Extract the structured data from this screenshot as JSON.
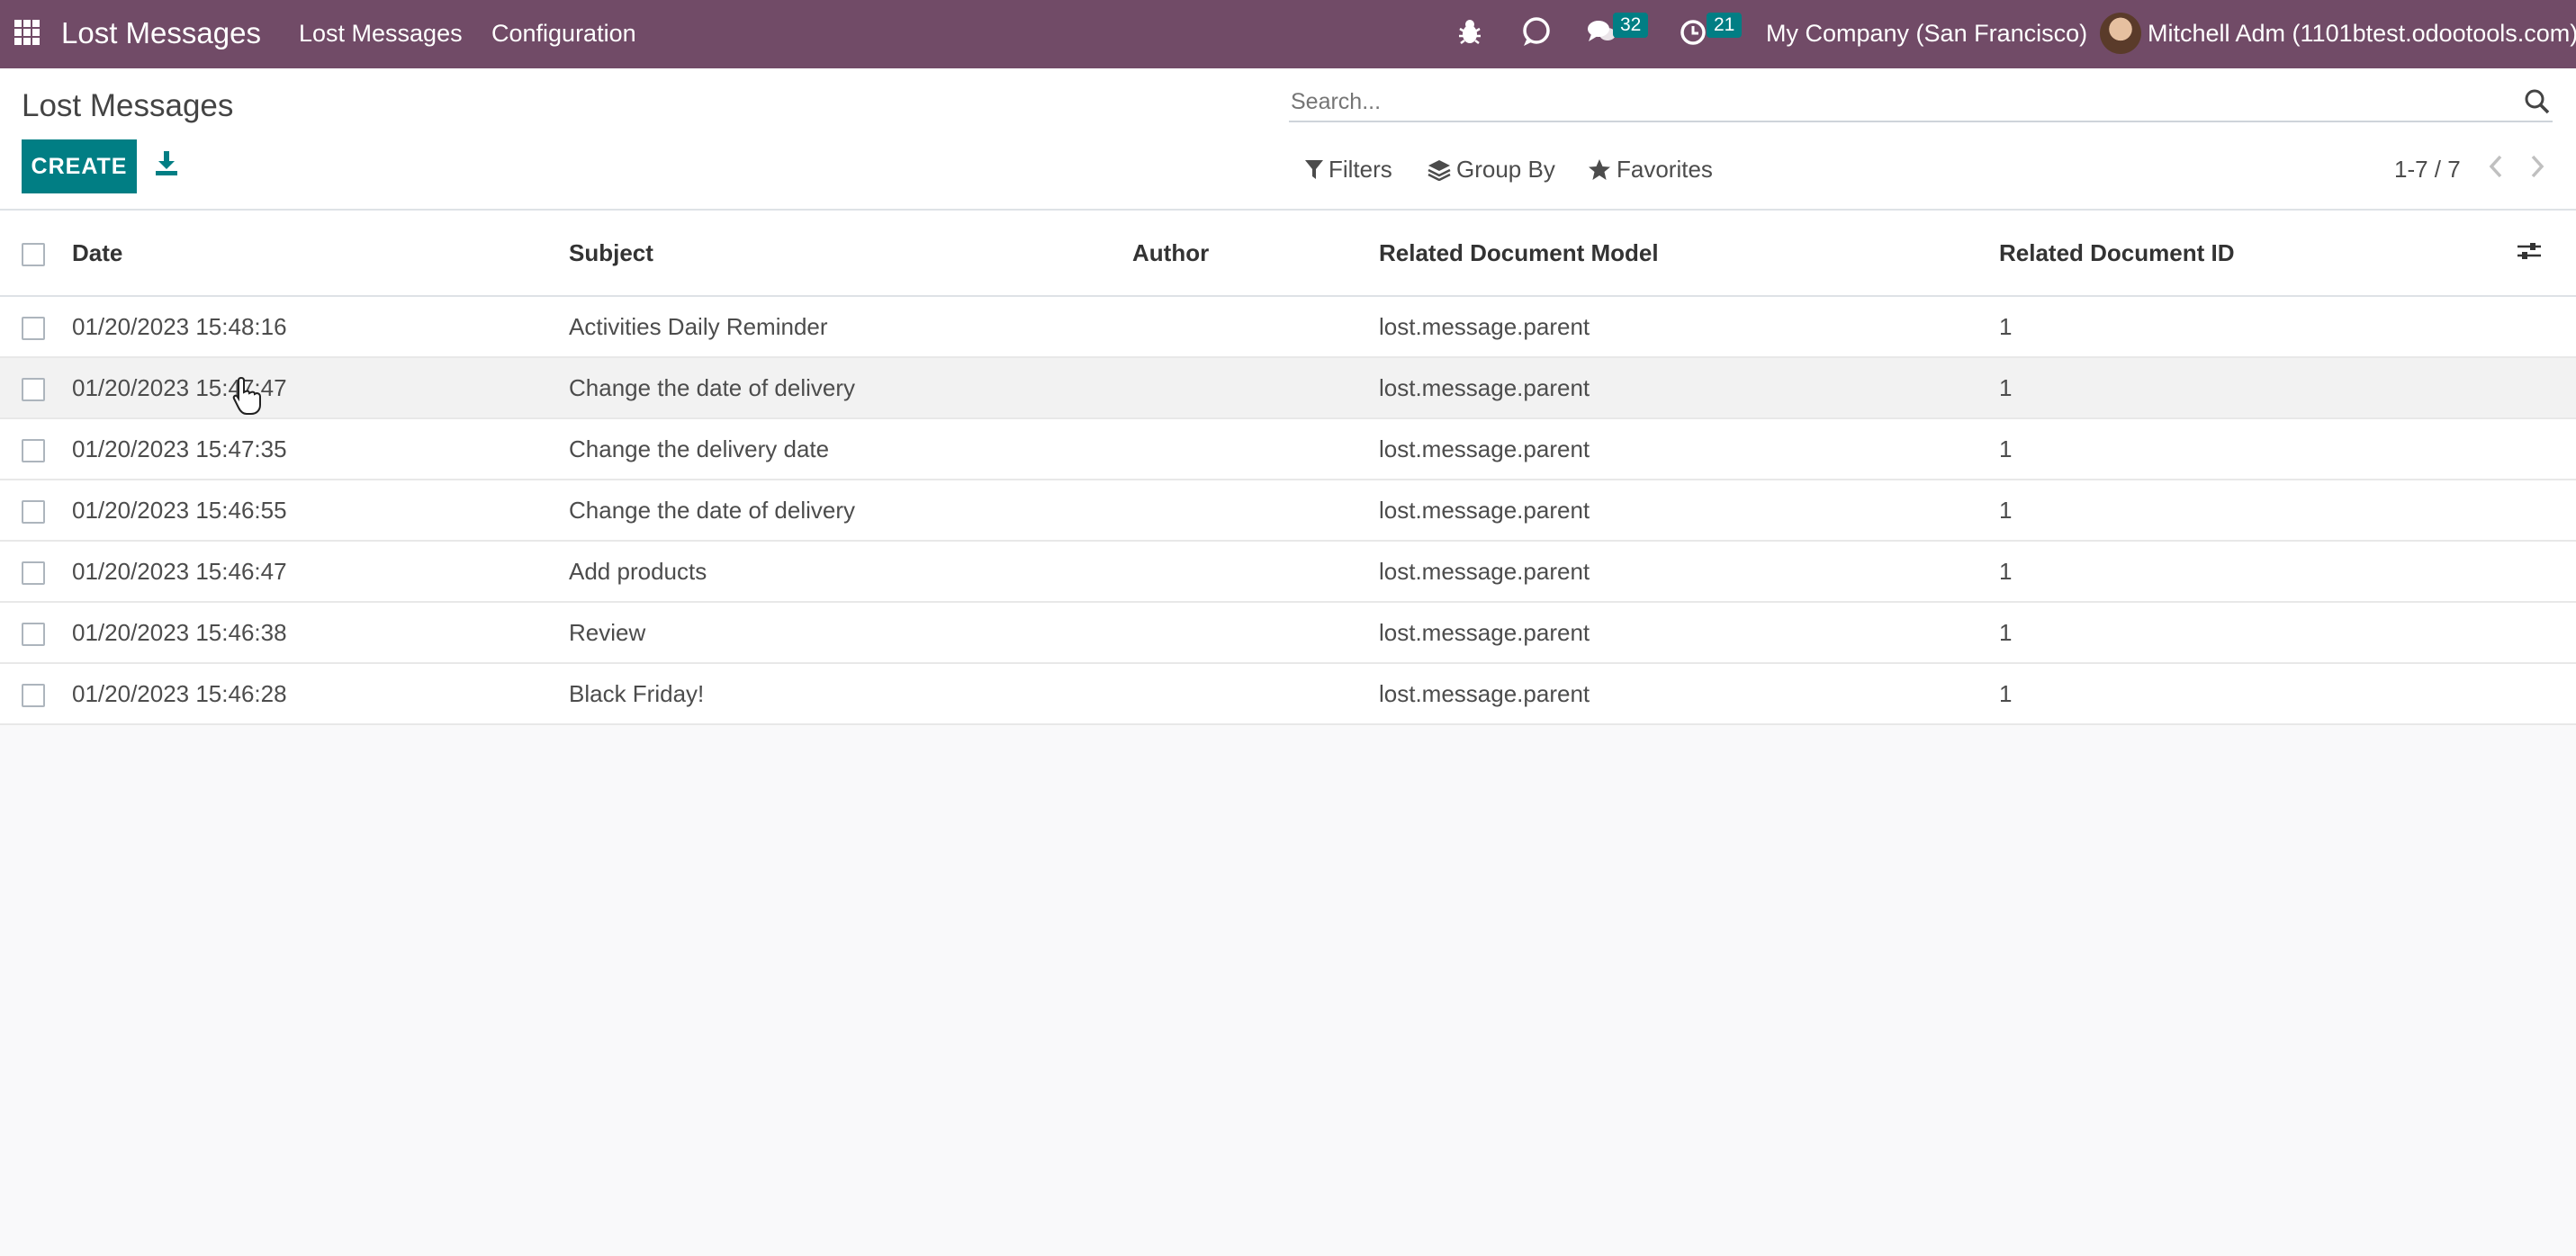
{
  "topbar": {
    "app_name": "Lost Messages",
    "menu": [
      "Lost Messages",
      "Configuration"
    ],
    "messages_count": "32",
    "activities_count": "21",
    "company": "My Company (San Francisco)",
    "user": "Mitchell Adm (1101btest.odootools.com)"
  },
  "control_panel": {
    "title": "Lost Messages",
    "create_label": "CREATE",
    "search_placeholder": "Search...",
    "filters_label": "Filters",
    "group_by_label": "Group By",
    "favorites_label": "Favorites",
    "pager": "1-7 / 7"
  },
  "table": {
    "columns": [
      "Date",
      "Subject",
      "Author",
      "Related Document Model",
      "Related Document ID"
    ],
    "rows": [
      {
        "date": "01/20/2023 15:48:16",
        "subject": "Activities Daily Reminder",
        "author": "",
        "model": "lost.message.parent",
        "res_id": "1"
      },
      {
        "date": "01/20/2023 15:47:47",
        "subject": "Change the date of delivery",
        "author": "",
        "model": "lost.message.parent",
        "res_id": "1"
      },
      {
        "date": "01/20/2023 15:47:35",
        "subject": "Change the delivery date",
        "author": "",
        "model": "lost.message.parent",
        "res_id": "1"
      },
      {
        "date": "01/20/2023 15:46:55",
        "subject": "Change the date of delivery",
        "author": "",
        "model": "lost.message.parent",
        "res_id": "1"
      },
      {
        "date": "01/20/2023 15:46:47",
        "subject": "Add products",
        "author": "",
        "model": "lost.message.parent",
        "res_id": "1"
      },
      {
        "date": "01/20/2023 15:46:38",
        "subject": "Review",
        "author": "",
        "model": "lost.message.parent",
        "res_id": "1"
      },
      {
        "date": "01/20/2023 15:46:28",
        "subject": "Black Friday!",
        "author": "",
        "model": "lost.message.parent",
        "res_id": "1"
      }
    ]
  },
  "colors": {
    "navbar": "#714b67",
    "primary": "#017e84"
  }
}
